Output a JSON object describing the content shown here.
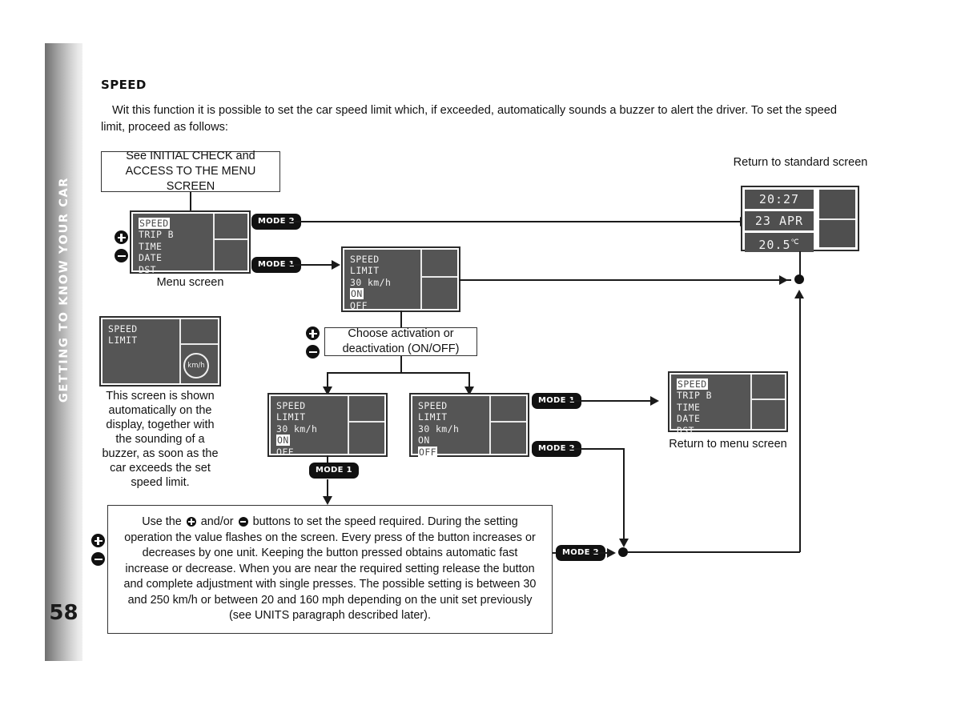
{
  "sidebar": {
    "chapter_label": "GETTING TO KNOW YOUR CAR",
    "page_number": "58"
  },
  "header": {
    "title": "SPEED",
    "intro": "Wit this function it is possible to set the car speed limit which, if exceeded, automatically sounds a buzzer to alert the driver. To set the speed limit, proceed as follows:"
  },
  "flow": {
    "start_box": "See INITIAL CHECK and ACCESS TO THE MENU SCREEN",
    "menu_screen_caption": "Menu screen",
    "choose_box": "Choose activation or deactivation (ON/OFF)",
    "return_standard_caption": "Return to standard screen",
    "return_menu_caption": "Return to menu screen",
    "buzzer_caption": "This screen is shown automatically on the display, together with the sounding of a buzzer, as soon as the car exceeds the set speed limit.",
    "instruction_text_part1": "Use the",
    "instruction_text_part2": "and/or",
    "instruction_text_part3": "buttons to set the speed required. During the setting operation the value flashes on the screen. Every press of the button increases or decreases by one unit. Keeping the button pressed obtains automatic fast increase or decrease. When you are near the required setting release the button and complete adjustment with single presses. The possible setting is between 30 and 250 km/h or between 20 and 160 mph depending on the unit set previously (see UNITS paragraph described later)."
  },
  "badges": {
    "mode2_top": "MODE 2",
    "mode1_top": "MODE 1",
    "mode1_right": "MODE 1",
    "mode2_right": "MODE 2",
    "mode1_bottom": "MODE 1",
    "mode2_bottom": "MODE 2"
  },
  "screens": {
    "menu": {
      "rows": [
        "SPEED",
        "TRIP B",
        "TIME",
        "DATE",
        "DST"
      ],
      "highlighted": "SPEED"
    },
    "menu_return": {
      "rows": [
        "SPEED",
        "TRIP B",
        "TIME",
        "DATE",
        "DST"
      ],
      "highlighted": "SPEED"
    },
    "speed_limit_main": {
      "rows": [
        "SPEED",
        "LIMIT",
        "30 km/h",
        "ON",
        "OFF"
      ],
      "highlighted": "ON"
    },
    "speed_limit_on": {
      "rows": [
        "SPEED",
        "LIMIT",
        "30 km/h",
        "ON",
        "OFF"
      ],
      "highlighted": "ON"
    },
    "speed_limit_off": {
      "rows": [
        "SPEED",
        "LIMIT",
        "30 km/h",
        "ON",
        "OFF"
      ],
      "highlighted": "OFF"
    },
    "alarm": {
      "rows": [
        "SPEED",
        "LIMIT"
      ],
      "unit_badge": "km/h"
    },
    "standard": {
      "time": "20:27",
      "date": "23 APR",
      "temperature": "20.5",
      "temperature_unit": "℃"
    }
  },
  "colors": {
    "screen_bg": "#555555",
    "screen_text": "#f2f2f2",
    "badge_bg": "#111111",
    "line": "#1a1a1a"
  }
}
